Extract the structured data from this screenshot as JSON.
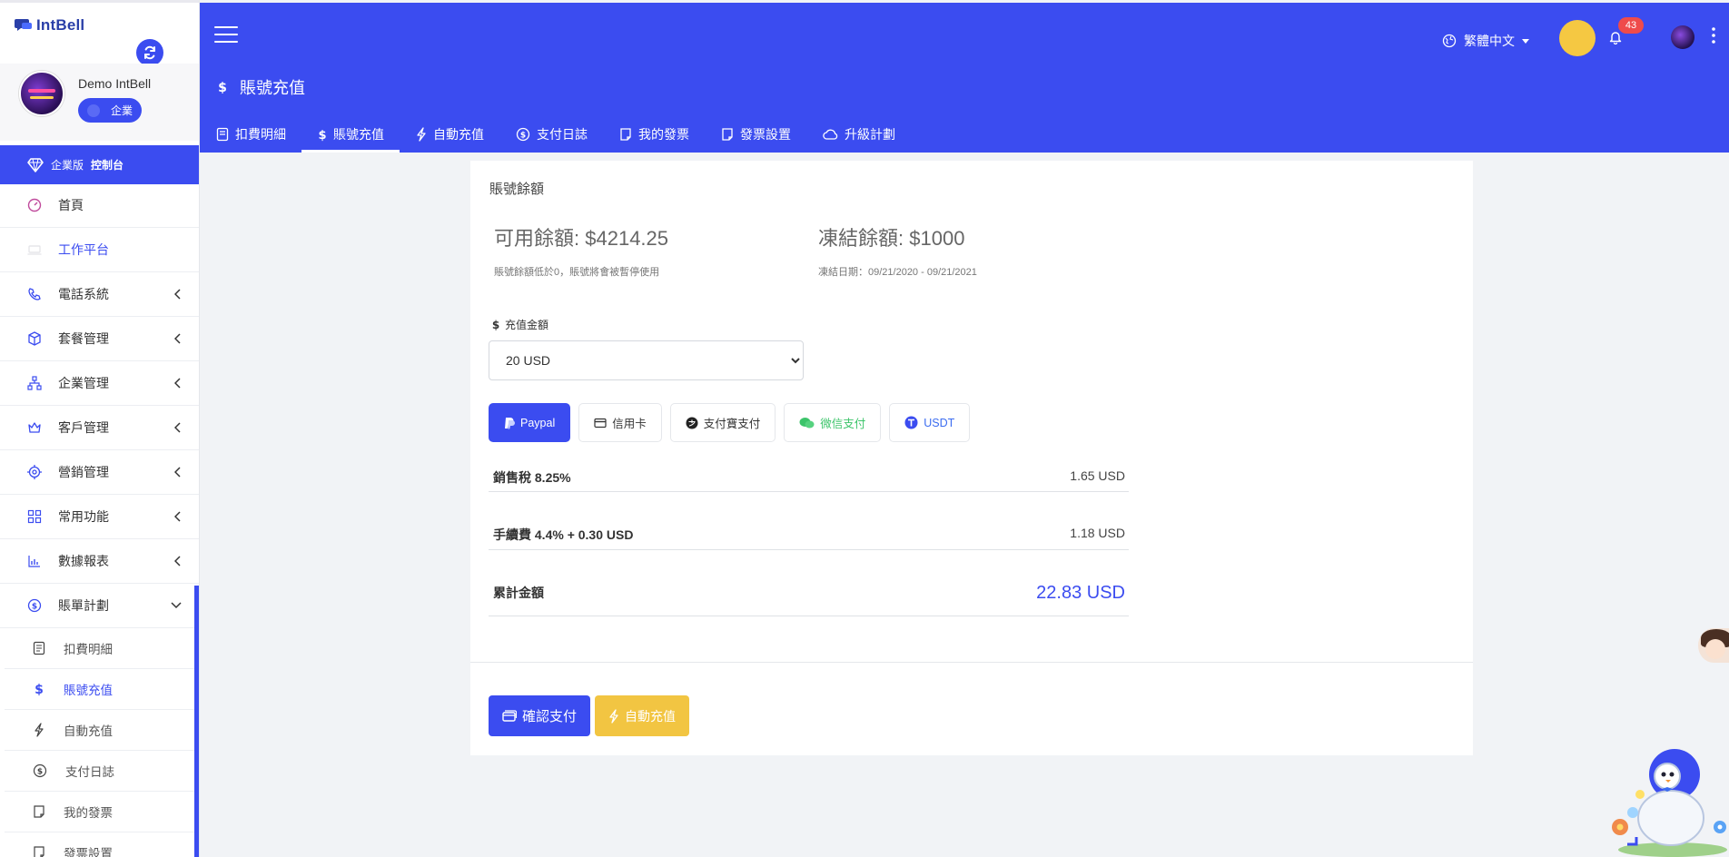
{
  "app": {
    "logo_text": "IntBell",
    "user_name": "Demo IntBell",
    "role_badge": "企業",
    "console": {
      "prefix": "企業版",
      "bold": "控制台"
    }
  },
  "sidebar": {
    "items": [
      {
        "label": "首頁",
        "icon": "dashboard-gauge-icon"
      },
      {
        "label": "工作平台",
        "icon": "laptop-icon"
      },
      {
        "label": "電話系統",
        "icon": "phone-icon"
      },
      {
        "label": "套餐管理",
        "icon": "package-box-icon"
      },
      {
        "label": "企業管理",
        "icon": "org-chart-icon"
      },
      {
        "label": "客戶管理",
        "icon": "crown-icon"
      },
      {
        "label": "營銷管理",
        "icon": "target-icon"
      },
      {
        "label": "常用功能",
        "icon": "grid-icon"
      },
      {
        "label": "數據報表",
        "icon": "bar-chart-icon"
      },
      {
        "label": "賬單計劃",
        "icon": "dollar-circle-icon"
      }
    ],
    "subitems": [
      {
        "label": "扣費明細"
      },
      {
        "label": "賬號充值"
      },
      {
        "label": "自動充值"
      },
      {
        "label": "支付日誌"
      },
      {
        "label": "我的發票"
      },
      {
        "label": "發票設置"
      }
    ]
  },
  "header": {
    "language": "繁體中文",
    "notification_count": "43",
    "page_title": "賬號充值",
    "tabs": [
      {
        "label": "扣費明細"
      },
      {
        "label": "賬號充值"
      },
      {
        "label": "自動充值"
      },
      {
        "label": "支付日誌"
      },
      {
        "label": "我的發票"
      },
      {
        "label": "發票設置"
      },
      {
        "label": "升級計劃"
      }
    ]
  },
  "account": {
    "section_title": "賬號餘額",
    "available_label": "可用餘額:",
    "available_value": "$4214.25",
    "available_note": "賬號餘額低於0，賬號將會被暫停使用",
    "frozen_label": "凍結餘額:",
    "frozen_value": "$1000",
    "frozen_note": "凍結日期：09/21/2020 - 09/21/2021"
  },
  "recharge": {
    "amount_label": "充值金額",
    "selected_amount": "20 USD",
    "payment_methods": [
      {
        "label": "Paypal",
        "active": true
      },
      {
        "label": "信用卡"
      },
      {
        "label": "支付寶支付"
      },
      {
        "label": "微信支付"
      },
      {
        "label": "USDT"
      }
    ],
    "fees": [
      {
        "name": "銷售稅 8.25%",
        "value": "1.65 USD"
      },
      {
        "name": "手續費 4.4% + 0.30 USD",
        "value": "1.18 USD"
      }
    ],
    "total_label": "累計金額",
    "total_value": "22.83 USD",
    "confirm_label": "確認支付",
    "auto_label": "自動充值"
  },
  "colors": {
    "primary": "#3b4cf0",
    "accent_yellow": "#f2c542",
    "badge_red": "#ef4b4b",
    "wechat_green": "#3cc46a"
  }
}
